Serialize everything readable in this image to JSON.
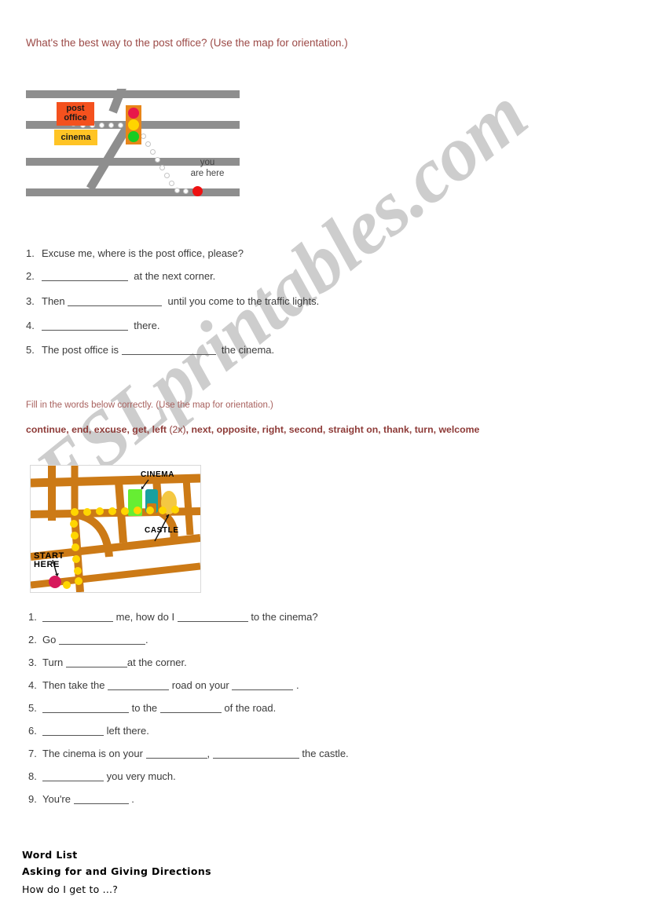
{
  "page": {
    "watermark": "ESLprintables.com"
  },
  "section1": {
    "heading": "What's the best way to the post office? (Use the map for orientation.)",
    "map": {
      "name": "street-map-post-office",
      "post_office_label": "post office",
      "cinema_label": "cinema",
      "you_are_here_label": "you are here",
      "you_are_here_line1": "you",
      "you_are_here_line2": "are here",
      "traffic_light": "traffic-light",
      "colors": {
        "road": "#8e8e8e",
        "post_office": "#f4511e",
        "cinema": "#ffc425",
        "light_body": "#e8861a",
        "lamp_red": "#e8174a",
        "lamp_amber": "#ffd500",
        "lamp_green": "#17cc22",
        "marker": "#ee1111"
      }
    },
    "questions": [
      {
        "num": "1.",
        "before": "Excuse me, where is the post office, please?",
        "after": ""
      },
      {
        "num": "2.",
        "before": "",
        "after": "at the next corner."
      },
      {
        "num": "3.",
        "before": "Then",
        "after": "until you come to the traffic lights."
      },
      {
        "num": "4.",
        "before": "",
        "after": "there."
      },
      {
        "num": "5.",
        "before": "The post office is",
        "after": "the cinema."
      }
    ]
  },
  "section2": {
    "instruction": "Fill in the words below correctly. (Use the map for orientation.)",
    "wordbank_line1": "continue, end, excuse, get, left",
    "wordbank_paren": "(2x)",
    "wordbank_line1b": ", next, opposite, right, second, straight on, thank, turn,",
    "wordbank_line2": "welcome",
    "wordbank_full": "continue, end, excuse, get, left (2x), next, opposite, right, second, straight on, thank, turn, welcome",
    "map": {
      "name": "city-map-cinema-castle",
      "cinema_label": "CINEMA",
      "castle_label": "CASTLE",
      "start_line1": "START",
      "start_line2": "HERE",
      "colors": {
        "road": "#cc7a16",
        "route_dot": "#ffd600",
        "cinema_building": "#66ee33",
        "car": "#18a0a0",
        "castle": "#f4c842",
        "start_marker": "#d6185c"
      }
    },
    "questions": [
      {
        "num": "1.",
        "before": "",
        "mid": "me, how do I",
        "after": "to the cinema?"
      },
      {
        "num": "2.",
        "before": "Go",
        "mid": "",
        "after": "."
      },
      {
        "num": "3.",
        "before": "Turn",
        "mid": "",
        "after": "at the corner."
      },
      {
        "num": "4.",
        "before": "Then take the",
        "mid": "road on your",
        "after": "."
      },
      {
        "num": "5.",
        "before": "",
        "mid": "to the",
        "after": "of the road."
      },
      {
        "num": "6.",
        "before": "",
        "mid": "",
        "after": "left there."
      },
      {
        "num": "7.",
        "before": "The cinema is on your",
        "mid": ",",
        "after": "the castle."
      },
      {
        "num": "8.",
        "before": "",
        "mid": "",
        "after": "you very much."
      },
      {
        "num": "9.",
        "before": "You're",
        "mid": "",
        "after": "."
      }
    ]
  },
  "footer": {
    "word_list_title": "Word List",
    "subtitle": "Asking for and Giving Directions",
    "line1": "How do I get to ...?"
  }
}
